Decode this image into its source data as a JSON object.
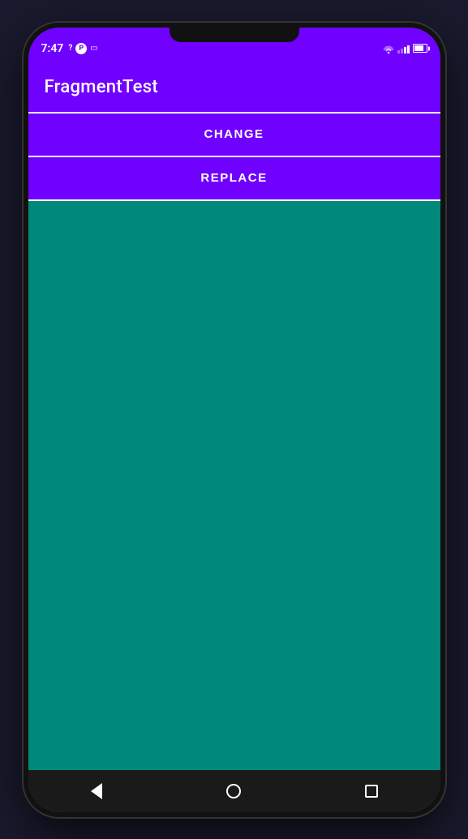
{
  "app": {
    "title": "FragmentTest"
  },
  "status_bar": {
    "time": "7:47"
  },
  "buttons": {
    "change_label": "CHANGE",
    "replace_label": "REPLACE"
  },
  "colors": {
    "purple": "#7000ff",
    "teal": "#00897b",
    "white": "#ffffff"
  },
  "nav": {
    "back_icon": "back-chevron",
    "home_icon": "home-circle",
    "recents_icon": "recents-square"
  }
}
